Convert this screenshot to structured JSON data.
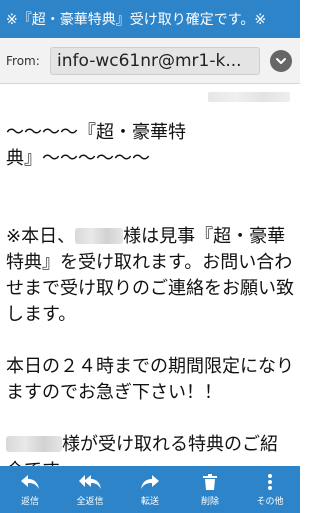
{
  "title_bar": {
    "subject": "※『超・豪華特典』受け取り確定です。※"
  },
  "header": {
    "from_label": "From:",
    "from_address": "info-wc61nr@mr1-k..."
  },
  "body": {
    "heading_line": "〜〜〜〜『超・豪華特典』〜〜〜〜〜〜",
    "para1_prefix": "※本日、",
    "para1_suffix": "様は見事『超・豪華特典』を受け取れます。お問い合わせまで受け取りのご連絡をお願い致します。",
    "para2": "本日の２４時までの期間限定になりますのでお急ぎ下さい！！",
    "para3_suffix": "様が受け取れる特典のご紹介です。"
  },
  "toolbar": {
    "items": [
      {
        "label": "返信",
        "icon": "reply-icon"
      },
      {
        "label": "全返信",
        "icon": "reply-all-icon"
      },
      {
        "label": "転送",
        "icon": "forward-icon"
      },
      {
        "label": "削除",
        "icon": "trash-icon"
      },
      {
        "label": "その他",
        "icon": "more-icon"
      }
    ]
  },
  "colors": {
    "bar": "#2e84c8",
    "header_bg": "#f2f2f2"
  }
}
